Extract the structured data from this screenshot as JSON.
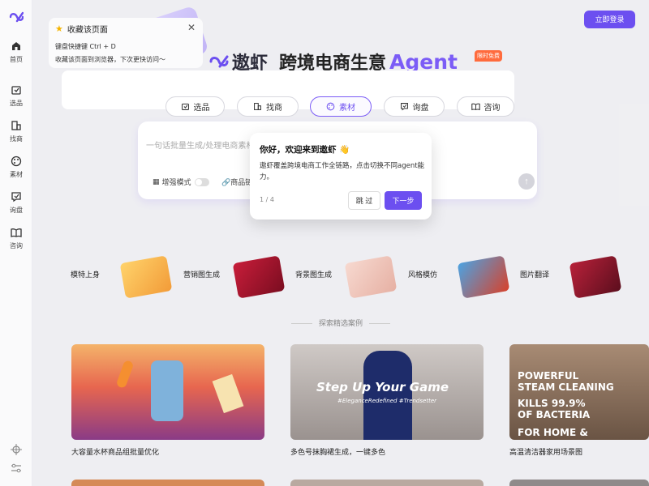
{
  "app": {
    "name": "遨虾",
    "slogan": "跨境电商生意",
    "agent_word": "Agent",
    "limited_badge": "限时免费",
    "login_label": "立即登录"
  },
  "sidebar": {
    "items": [
      {
        "label": "首页",
        "icon": "home-icon"
      },
      {
        "label": "选品",
        "icon": "product-select-icon"
      },
      {
        "label": "找商",
        "icon": "supplier-icon"
      },
      {
        "label": "素材",
        "icon": "palette-icon"
      },
      {
        "label": "询盘",
        "icon": "inquiry-icon"
      },
      {
        "label": "咨询",
        "icon": "book-icon"
      }
    ],
    "bottom_icons": [
      "target-icon",
      "sliders-icon"
    ]
  },
  "bookmark": {
    "title": "收藏该页面",
    "shortcut": "键盘快捷键  Ctrl + D",
    "desc": "收藏该页面到浏览器，下次更快访问～"
  },
  "tabs": [
    {
      "label": "选品",
      "icon": "product-select-icon"
    },
    {
      "label": "找商",
      "icon": "supplier-icon"
    },
    {
      "label": "素材",
      "icon": "palette-icon",
      "active": true
    },
    {
      "label": "询盘",
      "icon": "inquiry-icon"
    },
    {
      "label": "咨询",
      "icon": "book-icon"
    }
  ],
  "input": {
    "placeholder": "一句话批量生成/处理电商素材",
    "enhance_label": "增强模式",
    "product_link_label": "商品链"
  },
  "tour": {
    "title": "你好，欢迎来到遨虾 👋",
    "body": "遨虾覆盖跨境电商工作全链路，点击切换不同agent能力。",
    "step": "1 / 4",
    "skip_label": "跳 过",
    "next_label": "下一步"
  },
  "features": [
    {
      "label": "模特上身"
    },
    {
      "label": "营销图生成"
    },
    {
      "label": "背景图生成"
    },
    {
      "label": "风格模仿"
    },
    {
      "label": "图片翻译"
    }
  ],
  "section_title": "探索精选案例",
  "cases": [
    {
      "caption": "大容量水杯商品组批量优化"
    },
    {
      "caption": "多色号抹胸裙生成，一键多色",
      "overlay1": "Step Up Your Game",
      "overlay2": "#EleganceRedefined #Trendsetter"
    },
    {
      "caption": "高温清洁器家用场景图",
      "overlay1": "POWERFUL",
      "overlay2": "STEAM CLEANING",
      "overlay3": "KILLS 99.9%",
      "overlay4": "OF BACTERIA",
      "overlay5": "FOR HOME &"
    }
  ],
  "colors": {
    "accent": "#6c4ff0",
    "agent": "#7b5cf6",
    "badge": "#ff6b3d"
  }
}
